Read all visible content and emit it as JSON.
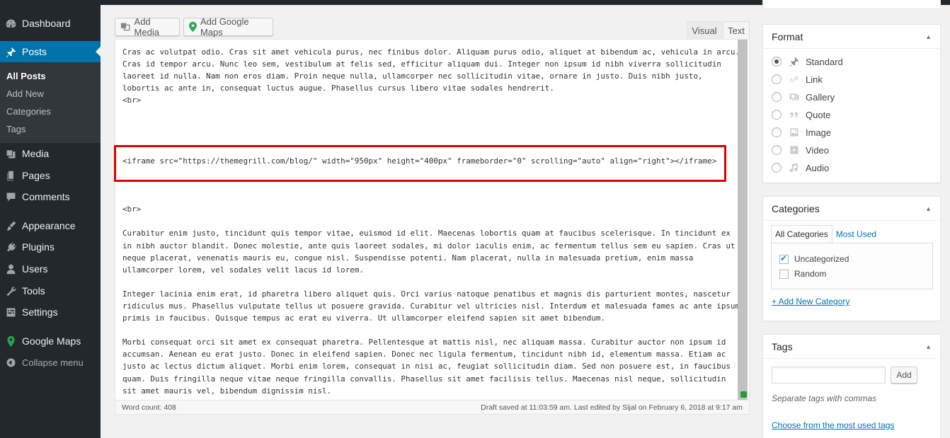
{
  "sidebar": {
    "items": [
      {
        "label": "Dashboard",
        "icon": "dashboard-icon"
      },
      {
        "label": "Posts",
        "icon": "pin-icon"
      },
      {
        "label": "Media",
        "icon": "media-icon"
      },
      {
        "label": "Pages",
        "icon": "pages-icon"
      },
      {
        "label": "Comments",
        "icon": "comment-icon"
      },
      {
        "label": "Appearance",
        "icon": "brush-icon"
      },
      {
        "label": "Plugins",
        "icon": "plug-icon"
      },
      {
        "label": "Users",
        "icon": "user-icon"
      },
      {
        "label": "Tools",
        "icon": "wrench-icon"
      },
      {
        "label": "Settings",
        "icon": "settings-icon"
      },
      {
        "label": "Google Maps",
        "icon": "map-pin-icon"
      },
      {
        "label": "Collapse menu",
        "icon": "collapse-icon"
      }
    ],
    "submenu": [
      "All Posts",
      "Add New",
      "Categories",
      "Tags"
    ],
    "accent": "#0073aa"
  },
  "toolbar": {
    "add_media": "Add Media",
    "add_google_maps": "Add Google Maps"
  },
  "editor": {
    "tab_visual": "Visual",
    "tab_text": "Text",
    "content": "Cras ac volutpat odio. Cras sit amet vehicula purus, nec finibus dolor. Aliquam purus odio, aliquet at bibendum ac, vehicula in arcu.\nCras id tempor arcu. Nunc leo sem, vestibulum at felis sed, efficitur aliquam dui. Integer non ipsum id nibh viverra sollicitudin\nlaoreet id nulla. Nam non eros diam. Proin neque nulla, ullamcorper nec sollicitudin vitae, ornare in justo. Duis nibh justo,\nlobortis ac ante in, consequat luctus augue. Phasellus cursus libero vitae sodales hendrerit.\n<br>\n\n\n\n\n<iframe src=\"https://themegrill.com/blog/\" width=\"950px\" height=\"400px\" frameborder=\"0\" scrolling=\"auto\" align=\"right\"></iframe>\n\n\n\n<br>\n\nCurabitur enim justo, tincidunt quis tempor vitae, euismod id elit. Maecenas lobortis quam at faucibus scelerisque. In tincidunt ex\nin nibh auctor blandit. Donec molestie, ante quis laoreet sodales, mi dolor iaculis enim, ac fermentum tellus sem eu sapien. Cras ut\nneque placerat, venenatis mauris eu, congue nisl. Suspendisse potenti. Nam placerat, nulla in malesuada pretium, enim massa\nullamcorper lorem, vel sodales velit lacus id lorem.\n\nInteger lacinia enim erat, id pharetra libero aliquet quis. Orci varius natoque penatibus et magnis dis parturient montes, nascetur\nridiculus mus. Phasellus vulputate tellus ut posuere gravida. Curabitur vel ultricies nisl. Interdum et malesuada fames ac ante ipsum\nprimis in faucibus. Quisque tempus ac erat eu viverra. Ut ullamcorper eleifend sapien sit amet bibendum.\n\nMorbi consequat orci sit amet ex consequat pharetra. Pellentesque at mattis nisl, nec aliquam massa. Curabitur auctor non ipsum id\naccumsan. Aenean eu erat justo. Donec in eleifend sapien. Donec nec ligula fermentum, tincidunt nibh id, elementum massa. Etiam ac\njusto ac lectus dictum aliquet. Morbi enim lorem, consequat in nisi ac, feugiat sollicitudin diam. Sed non posuere est, in faucibus\nquam. Duis fringilla neque vitae neque fringilla convallis. Phasellus sit amet facilisis tellus. Maecenas nisl neque, sollicitudin\nsit amet mauris vel, bibendum dignissim nisl.",
    "word_count": "Word count: 408",
    "draft_status": "Draft saved at 11:03:59 am. Last edited by Sijal on February 6, 2018 at 9:17 am",
    "highlight_color": "#e00000"
  },
  "format_panel": {
    "title": "Format",
    "options": [
      {
        "label": "Standard",
        "icon": "pin-icon",
        "selected": true
      },
      {
        "label": "Link",
        "icon": "link-icon",
        "selected": false
      },
      {
        "label": "Gallery",
        "icon": "gallery-icon",
        "selected": false
      },
      {
        "label": "Quote",
        "icon": "quote-icon",
        "selected": false
      },
      {
        "label": "Image",
        "icon": "image-icon",
        "selected": false
      },
      {
        "label": "Video",
        "icon": "video-icon",
        "selected": false
      },
      {
        "label": "Audio",
        "icon": "audio-icon",
        "selected": false
      }
    ]
  },
  "categories_panel": {
    "title": "Categories",
    "tab_all": "All Categories",
    "tab_used": "Most Used",
    "items": [
      {
        "label": "Uncategorized",
        "checked": true
      },
      {
        "label": "Random",
        "checked": false
      }
    ],
    "add_link": "+ Add New Category"
  },
  "tags_panel": {
    "title": "Tags",
    "input_value": "",
    "add_button": "Add",
    "hint": "Separate tags with commas",
    "choose_link": "Choose from the most used tags"
  }
}
